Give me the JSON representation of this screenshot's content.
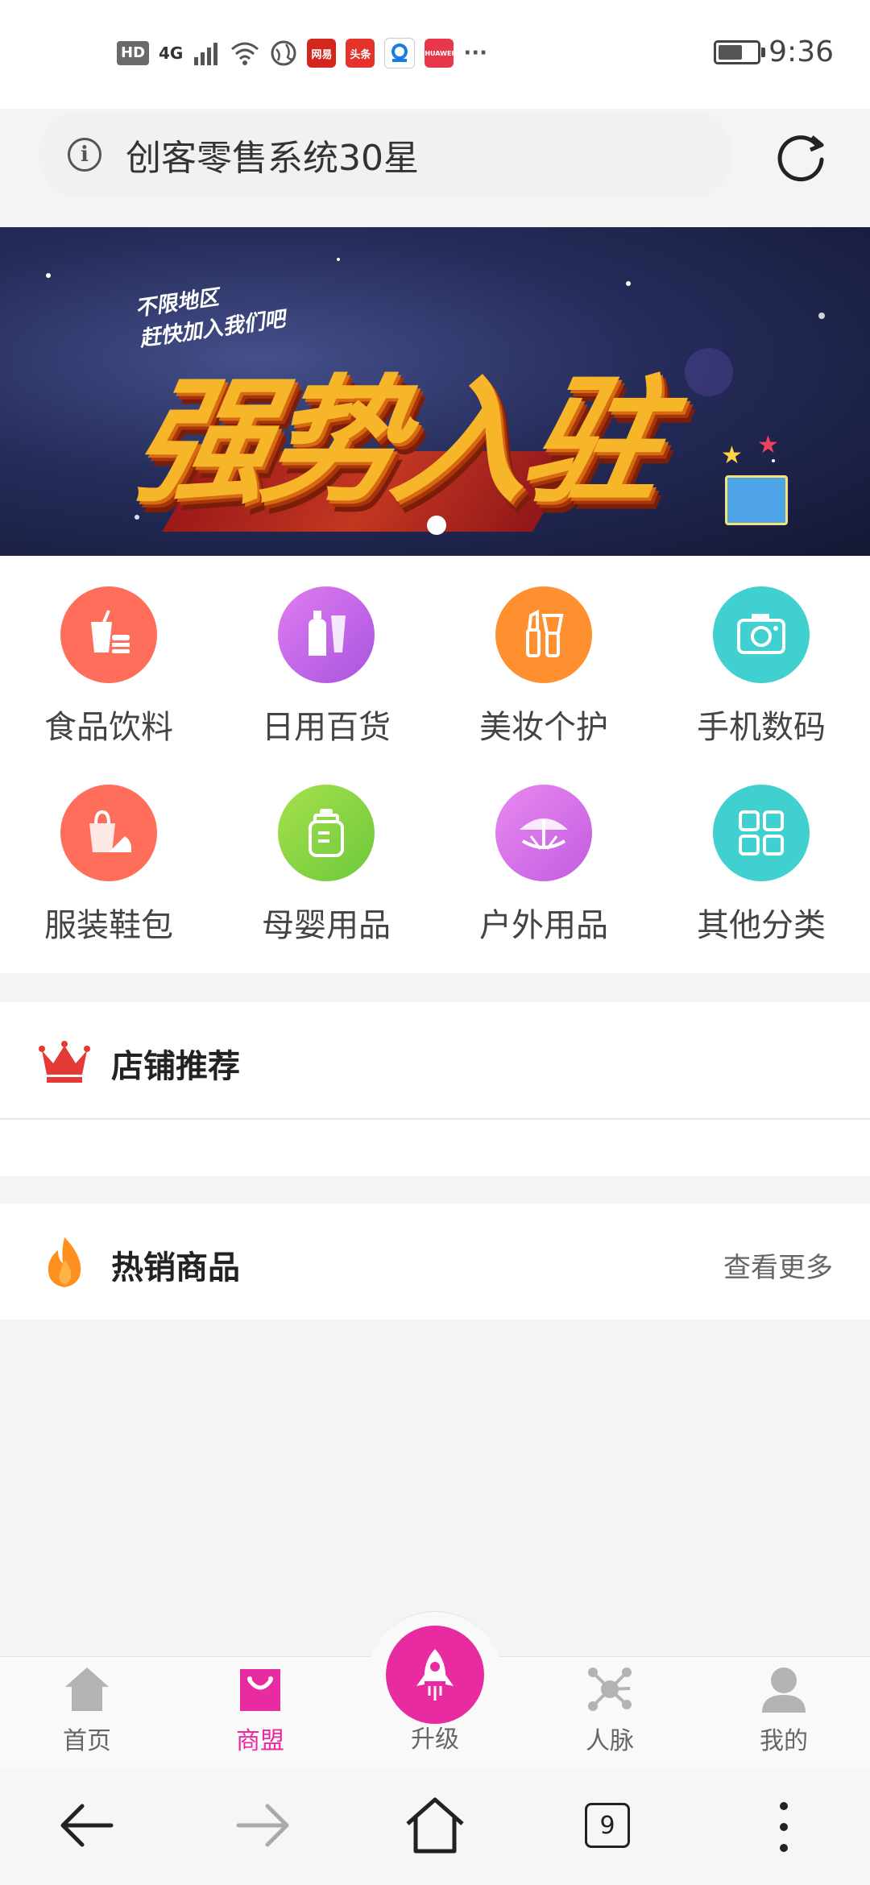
{
  "status_bar": {
    "hd_badge": "HD",
    "network": "4G",
    "apps": [
      "网易",
      "头条",
      "HUAWEI"
    ],
    "more": "···",
    "time": "9:36",
    "battery_level": 0.55
  },
  "browser": {
    "address_text": "创客零售系统30星",
    "info_icon": "info-icon",
    "refresh_icon": "refresh-icon",
    "tab_count": "9"
  },
  "banner": {
    "subtitle_line1": "不限地区",
    "subtitle_line2": "赶快加入我们吧",
    "headline": "强势入驻",
    "active_slide": 1
  },
  "categories": [
    {
      "label": "食品饮料",
      "icon": "food-drink-icon",
      "color": "#ff6e5a"
    },
    {
      "label": "日用百货",
      "icon": "lotion-bottle-icon",
      "color": "#c86ee6"
    },
    {
      "label": "美妆个护",
      "icon": "cosmetics-icon",
      "color": "#ff9030"
    },
    {
      "label": "手机数码",
      "icon": "camera-icon",
      "color": "#3fd0cf"
    },
    {
      "label": "服装鞋包",
      "icon": "bag-shoe-icon",
      "color": "#ff6e5a"
    },
    {
      "label": "母婴用品",
      "icon": "baby-bottle-icon",
      "color": "#8fdc4a"
    },
    {
      "label": "户外用品",
      "icon": "umbrella-icon",
      "color": "#d67ae8"
    },
    {
      "label": "其他分类",
      "icon": "grid-icon",
      "color": "#3fd0cf"
    }
  ],
  "sections": {
    "shop_recommend": {
      "title": "店铺推荐",
      "icon": "crown-icon"
    },
    "hot_products": {
      "title": "热销商品",
      "icon": "flame-icon",
      "more": "查看更多"
    }
  },
  "tabbar": {
    "items": [
      {
        "label": "首页",
        "icon": "home-icon"
      },
      {
        "label": "商盟",
        "icon": "shopping-bag-icon",
        "active": true
      },
      {
        "label": "升级",
        "icon": "rocket-icon"
      },
      {
        "label": "人脉",
        "icon": "network-icon"
      },
      {
        "label": "我的",
        "icon": "user-icon"
      }
    ]
  },
  "colors": {
    "accent": "#e82ba0",
    "crown": "#e53935",
    "flame": "#ff8f1f"
  }
}
